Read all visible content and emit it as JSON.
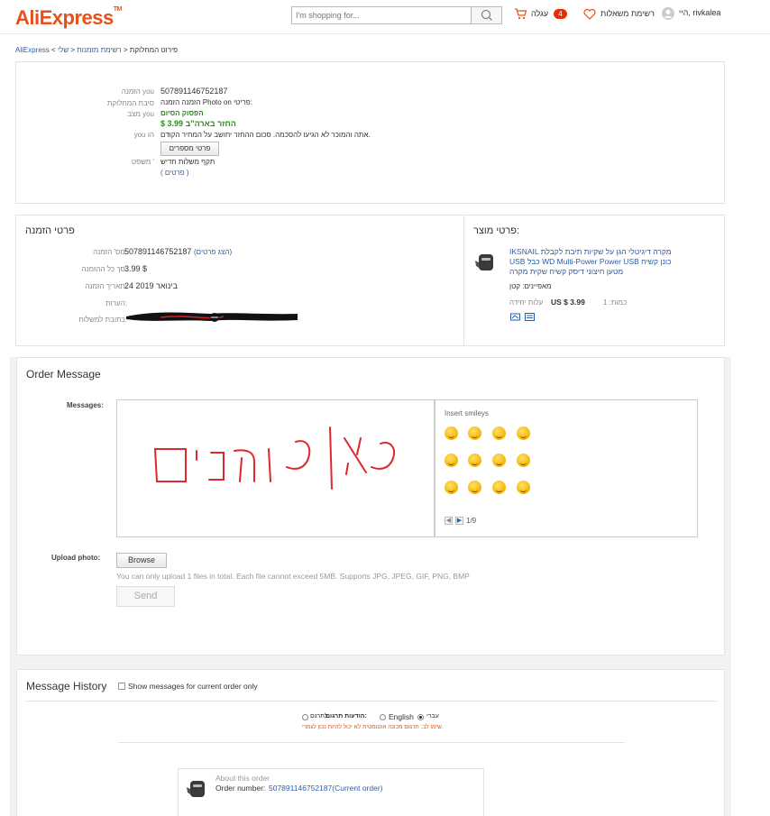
{
  "header": {
    "logo": "AliExpress",
    "logo_tm": "TM",
    "search_placeholder": "I'm shopping for...",
    "cart_label": "עגלה",
    "cart_count": "4",
    "wishlist_label": "רשימת משאלות",
    "user_greeting": "היי, rivkalea"
  },
  "breadcrumb": {
    "home": "AliExpress",
    "mine": "שלי",
    "orders": "רשימת מזמנות",
    "current": "פירוט המחלוקת"
  },
  "dispute": {
    "order_label": "הזמנה you",
    "order_value": "507891146752187",
    "reason_label": "סיבת המחלוקת",
    "reason_value": "הזמנה הזמנה Photo on פריטי:",
    "status_label": "מצב you",
    "status_value": "הפסוק הסיום",
    "refund_value": "$ החזר בארה\"ב 3.99",
    "you_label": "you הו",
    "you_value": "אתה והמוכר לא הגיעו להסכמה. סכום ההחזר יחושב על המחיר הקודם.",
    "details_button": "פרטי מספרים",
    "wording_label": "משפט '",
    "wording_value": "תקף משלות חדיש",
    "wording_link": "( פרטים )"
  },
  "order_details": {
    "title": "פרטי הזמנה",
    "rows": [
      {
        "label": "מס' הזמנה:",
        "value": "507891146752187",
        "link": "(הצג פרטים)"
      },
      {
        "label": "סך כל ההזמנה:",
        "value": "3.99 $",
        "link": ""
      },
      {
        "label": "תאריך הזמנה:",
        "value": "24 בינואר 2019",
        "link": ""
      },
      {
        "label": "הערות:",
        "value": "",
        "link": ""
      },
      {
        "label": "כתובת למשלוח:",
        "value": "",
        "link": ""
      }
    ]
  },
  "product": {
    "title": "פרטי מוצר:",
    "name_line1": "IKSNAIL מקרה דיגיטלי הגן על שקיות תיבת לקבלת",
    "name_line2": "USB כבל WD Multi-Power Power USB כונן קשיח",
    "name_line3": "מטען חיצוני דיסק קשיח שקית מקרה",
    "attributes": "מאפיינים: קטן",
    "price_label": "כמות: 1",
    "price_value": "US $ 3.99",
    "unit_label": "עלות יחידה"
  },
  "order_message": {
    "title": "Order Message",
    "messages_label": "Messages:",
    "handwriting": "כאן כותבים",
    "smileys_title": "Insert smileys",
    "smileys_page": "1/9",
    "upload_label": "Upload photo:",
    "browse_button": "Browse",
    "upload_hint": "You can only upload 1 files in total. Each file cannot exceed 5MB. Supports JPG, JPEG, GIF, PNG, BMP",
    "send_button": "Send"
  },
  "history": {
    "title": "Message History",
    "filter_label": "Show messages for current order only",
    "lang_label": "הודעות תרגום:",
    "lang_options": [
      "עברי",
      "English",
      "לתרגם"
    ],
    "lang_note": "שימו לב: תרגום מכונה אוטומטית לא יכול להיות נכון לגמרי.",
    "about_label": "About this order",
    "order_number_label": "Order number:",
    "order_number_value": "507891146752187(Current order)"
  },
  "colors": {
    "brand": "#e8501b",
    "link": "#2d5ea8",
    "handwriting": "#e0262e",
    "green": "#2f8a20",
    "badge": "#e62e04"
  }
}
